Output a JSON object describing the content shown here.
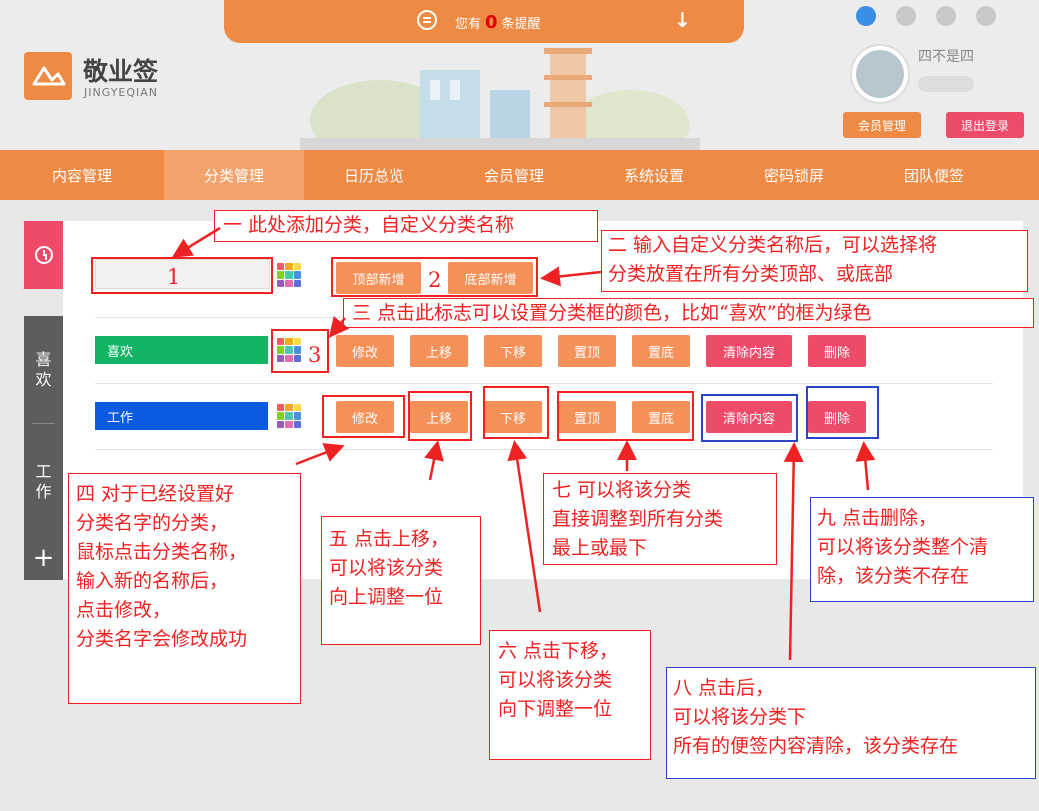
{
  "notice": {
    "prefix": "您有",
    "count": "0",
    "suffix": "条提醒"
  },
  "logo": {
    "title": "敬业签",
    "subtitle": "JINGYEQIAN"
  },
  "platforms": [
    "ie-icon",
    "windows-icon",
    "apple-icon",
    "android-icon"
  ],
  "user": {
    "name": "四不是四",
    "member_btn": "会员管理",
    "logout_btn": "退出登录"
  },
  "nav": [
    "内容管理",
    "分类管理",
    "日历总览",
    "会员管理",
    "系统设置",
    "密码锁屏",
    "团队便签"
  ],
  "nav_active": "分类管理",
  "side": {
    "cat1": [
      "喜",
      "欢"
    ],
    "cat2": [
      "工",
      "作"
    ],
    "add": "+"
  },
  "add_row": {
    "input_value": "",
    "top_add": "顶部新增",
    "bottom_add": "底部新增"
  },
  "categories": [
    {
      "name": "喜欢",
      "color": "#12b565"
    },
    {
      "name": "工作",
      "color": "#0b5ae0"
    }
  ],
  "actions": {
    "edit": "修改",
    "up": "上移",
    "down": "下移",
    "top": "置顶",
    "bottom": "置底",
    "clear": "清除内容",
    "delete": "删除"
  },
  "palette_colors": [
    "#f25b5b",
    "#f5a623",
    "#f7d94c",
    "#7ed321",
    "#4ec7b0",
    "#4a90e2",
    "#9b59b6",
    "#e06bb2",
    "#5b6ee0"
  ],
  "markers": {
    "m1": "1",
    "m2": "2",
    "m3": "3"
  },
  "notes": {
    "n1": "一  此处添加分类，自定义分类名称",
    "n2": [
      "二  输入自定义分类名称后，可以选择将",
      "分类放置在所有分类顶部、或底部"
    ],
    "n3": "三  点击此标志可以设置分类框的颜色，比如“喜欢”的框为绿色",
    "n4": [
      "四  对于已经设置好",
      "分类名字的分类，",
      "鼠标点击分类名称，",
      "输入新的名称后，",
      "点击修改，",
      "分类名字会修改成功"
    ],
    "n5": [
      "五  点击上移，",
      "可以将该分类",
      "向上调整一位"
    ],
    "n6": [
      "六  点击下移，",
      "可以将该分类",
      "向下调整一位"
    ],
    "n7": [
      "七  可以将该分类",
      "直接调整到所有分类",
      "最上或最下"
    ],
    "n8": [
      "八  点击后，",
      "可以将该分类下",
      "所有的便签内容清除，该分类存在"
    ],
    "n9": [
      "九  点击删除，",
      "可以将该分类整个清",
      "除，该分类不存在"
    ]
  },
  "colors": {
    "accent": "#ee8a44",
    "pink": "#ee4a6a",
    "annotation_red": "#e22222",
    "annotation_blue": "#2a44c8"
  }
}
